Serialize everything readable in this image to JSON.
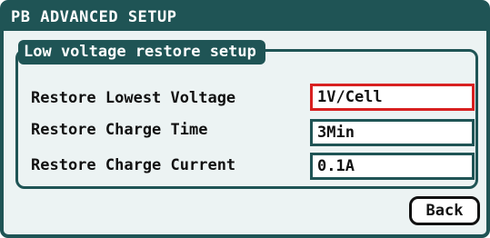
{
  "window": {
    "title": "PB ADVANCED SETUP"
  },
  "group": {
    "label": "Low voltage restore setup",
    "rows": [
      {
        "label": "Restore Lowest Voltage",
        "value": "1V/Cell",
        "selected": true
      },
      {
        "label": "Restore Charge Time",
        "value": "3Min",
        "selected": false
      },
      {
        "label": "Restore Charge Current",
        "value": "0.1A",
        "selected": false
      }
    ]
  },
  "buttons": {
    "back_label": "Back"
  },
  "colors": {
    "frame": "#1f5455",
    "background": "#ecf3f3",
    "selected_border": "#d82020"
  }
}
